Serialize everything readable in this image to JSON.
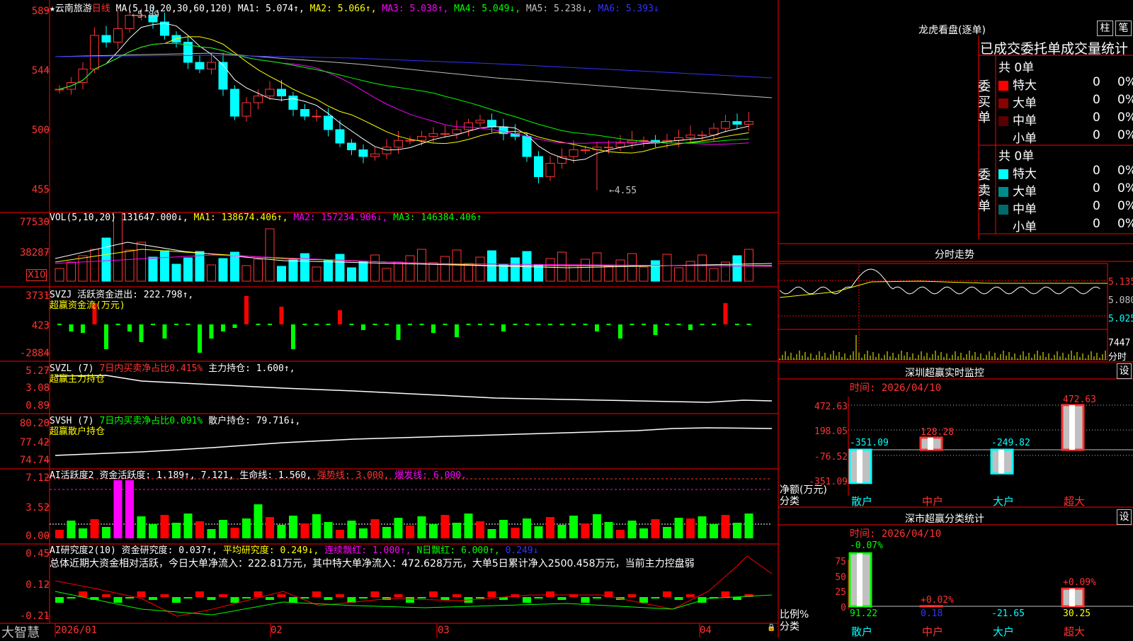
{
  "main_chart": {
    "stock_name": "★云南旅游",
    "period": "日线",
    "ma_label": "MA(5,10,20,30,60,120)",
    "ma1": "MA1: 5.074↑,",
    "ma2": "MA2: 5.066↑,",
    "ma3": "MA3: 5.038↑,",
    "ma4": "MA4: 5.049↓,",
    "ma5": "MA5: 5.238↓,",
    "ma6": "MA6: 5.393↓",
    "high_marker": "5.89",
    "low_marker": "4.55",
    "y_ticks": [
      "589",
      "544",
      "500",
      "455"
    ]
  },
  "vol_panel": {
    "label": "VOL(5,10,20)",
    "value": "131647.000↓,",
    "ma1": "MA1: 138674.406↑,",
    "ma2": "MA2: 157234.906↓,",
    "ma3": "MA3: 146384.406↑",
    "y_ticks": [
      "77530",
      "38287"
    ],
    "unit": "X10"
  },
  "svzj_panel": {
    "label": "SVZJ",
    "text": "活跃资金进出: 222.798↑,",
    "subtitle": "超赢资金流(万元)",
    "y_ticks": [
      "3731",
      "423",
      "-2884"
    ]
  },
  "svzl_panel": {
    "label": "SVZL (7)",
    "desc": "7日内买卖净占比0.415%",
    "hold": "主力持仓: 1.600↑,",
    "subtitle": "超赢主力持仓",
    "y_ticks": [
      "5.27",
      "3.08",
      "0.89"
    ]
  },
  "svsh_panel": {
    "label": "SVSH (7)",
    "desc": "7日内买卖净占比0.091%",
    "hold": "散户持仓: 79.716↓,",
    "subtitle": "超赢散户持仓",
    "y_ticks": [
      "80.20",
      "77.42",
      "74.74"
    ]
  },
  "ai2_panel": {
    "label": "AI活跃度2",
    "text1": "资金活跃度: 1.189↑,",
    "text2": "7.121,",
    "text3": "生命线: 1.560,",
    "text4": "强势线: 3.000,",
    "text5": "爆发线: 6.000,",
    "y_ticks": [
      "7.12",
      "3.52",
      "0.00"
    ]
  },
  "ai_research_panel": {
    "label": "AI研究度2(10)",
    "text1": "资金研究度: 0.037↑,",
    "text2": "平均研究度: 0.249↓,",
    "text3": "连续飘红: 1.000↑,",
    "text4": "N日飘红: 6.000↑,",
    "text5": "0.249↓",
    "summary": "总体近期大资金相对活跃，今日大单净流入：222.81万元，其中特大单净流入：472.628万元，大单5日累计净入2500.458万元，当前主力控盘弱",
    "y_ticks": [
      "0.45",
      "0.12",
      "-0.21"
    ]
  },
  "bottom_bar": {
    "brand": "大智慧",
    "dates": [
      "2026/01",
      "02",
      "03",
      "04"
    ]
  },
  "dragon_tiger": {
    "title": "龙虎看盘(逐单)",
    "btn_bar": "柱",
    "btn_stroke": "笔",
    "stats_title": "已成交委托单成交量统计",
    "buy_label": "委买单",
    "sell_label": "委卖单",
    "buy_total": "共 0单",
    "sell_total": "共 0单",
    "buy_rows": [
      {
        "name": "特大",
        "count": "0",
        "pct": "0%",
        "color": "#ff0000"
      },
      {
        "name": "大单",
        "count": "0",
        "pct": "0%",
        "color": "#8b0000"
      },
      {
        "name": "中单",
        "count": "0",
        "pct": "0%",
        "color": "#5a0000"
      },
      {
        "name": "小单",
        "count": "0",
        "pct": "0%",
        "color": ""
      }
    ],
    "sell_rows": [
      {
        "name": "特大",
        "count": "0",
        "pct": "0%",
        "color": "#00ffff"
      },
      {
        "name": "大单",
        "count": "0",
        "pct": "0%",
        "color": "#008b8b"
      },
      {
        "name": "中单",
        "count": "0",
        "pct": "0%",
        "color": "#006a6a"
      },
      {
        "name": "小单",
        "count": "0",
        "pct": "0%",
        "color": ""
      }
    ]
  },
  "intraday": {
    "title": "分时走势",
    "price_ticks": [
      "5.135",
      "5.080",
      "5.025"
    ],
    "vol_top": "7447",
    "vol_label": "分时"
  },
  "sz_monitor": {
    "title": "深圳超赢实时监控",
    "settings": "设",
    "time": "时间: 2026/04/10",
    "y_ticks": [
      "472.63",
      "198.05",
      "-76.52",
      "-351.09"
    ],
    "ylabel": "净额(万元)",
    "xlabel": "分类",
    "categories": [
      "散户",
      "中户",
      "大户",
      "超大"
    ],
    "values": [
      -351.09,
      128.28,
      -249.82,
      472.63
    ],
    "value_labels": [
      "-351.09",
      "128.28",
      "-249.82",
      "472.63"
    ]
  },
  "sz_classify": {
    "title": "深市超赢分类统计",
    "settings": "设",
    "time": "时间: 2026/04/10",
    "y_ticks": [
      "75",
      "50",
      "25",
      "0"
    ],
    "ylabel": "比例%",
    "xlabel": "分类",
    "categories": [
      "散户",
      "中户",
      "大户",
      "超大"
    ],
    "values": [
      91.22,
      0.18,
      -21.65,
      30.25
    ],
    "value_labels": [
      "91.22",
      "0.18",
      "-21.65",
      "30.25"
    ],
    "change_labels": [
      "-0.07%",
      "+0.02%",
      "",
      "+0.09%"
    ]
  },
  "chart_data": {
    "type": "line",
    "title": "",
    "xlabel": "",
    "ylabel": "",
    "series": [
      {
        "name": "MA1",
        "values": [
          5.074
        ]
      }
    ],
    "ylim": [
      4.55,
      5.89
    ]
  },
  "colors": {
    "up": "#ff3333",
    "down": "#00ffff",
    "ma1": "#ffffff",
    "ma2": "#ffff00",
    "ma3": "#ff00ff",
    "ma4": "#00ff00",
    "ma5": "#c0c0c0",
    "ma6": "#3333ff",
    "border": "#ff0000"
  }
}
